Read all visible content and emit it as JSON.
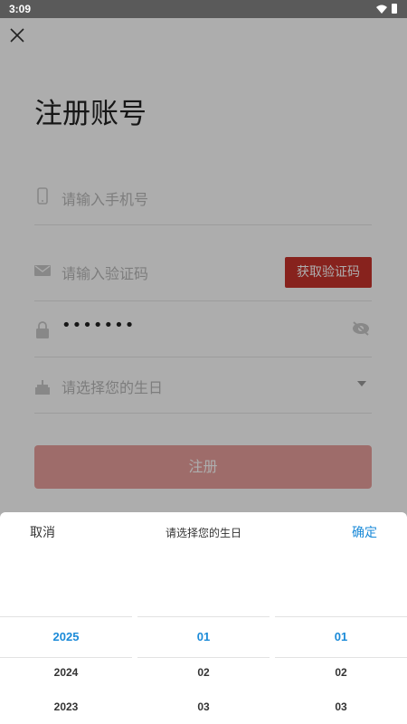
{
  "status_bar": {
    "time": "3:09",
    "wifi_icon": "wifi-icon",
    "battery_icon": "battery-icon"
  },
  "header": {
    "close_icon": "close-icon",
    "title": "注册账号"
  },
  "form": {
    "phone_placeholder": "请输入手机号",
    "code_placeholder": "请输入验证码",
    "get_code_label": "获取验证码",
    "password_value": "•••••••",
    "birthday_placeholder": "请选择您的生日",
    "register_label": "注册"
  },
  "colors": {
    "accent_red": "#c8332c",
    "disabled_red": "#e9a09c",
    "picker_blue": "#1a8ad8"
  },
  "picker": {
    "cancel_label": "取消",
    "title": "请选择您的生日",
    "confirm_label": "确定",
    "columns": [
      {
        "selected": "2025",
        "items": [
          "2024",
          "2023"
        ]
      },
      {
        "selected": "01",
        "items": [
          "02",
          "03"
        ]
      },
      {
        "selected": "01",
        "items": [
          "02",
          "03"
        ]
      }
    ]
  }
}
